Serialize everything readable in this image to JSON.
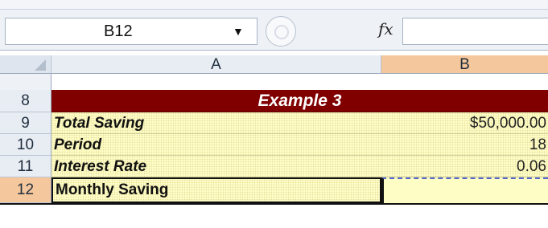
{
  "name_box": {
    "value": "B12"
  },
  "formula_bar": {
    "fx_label": "fx",
    "formula": ""
  },
  "columns": [
    "A",
    "B"
  ],
  "rows": [
    {
      "num": "8",
      "a": "Example 3",
      "b": ""
    },
    {
      "num": "9",
      "a": "Total Saving",
      "b": "$50,000.00"
    },
    {
      "num": "10",
      "a": "Period",
      "b": "18"
    },
    {
      "num": "11",
      "a": "Interest Rate",
      "b": "0.06"
    },
    {
      "num": "12",
      "a": "Monthly Saving",
      "b": ""
    }
  ],
  "colors": {
    "title_bg": "#800000",
    "selected_header": "#f5c79c",
    "cell_fill": "#fffdc6"
  }
}
